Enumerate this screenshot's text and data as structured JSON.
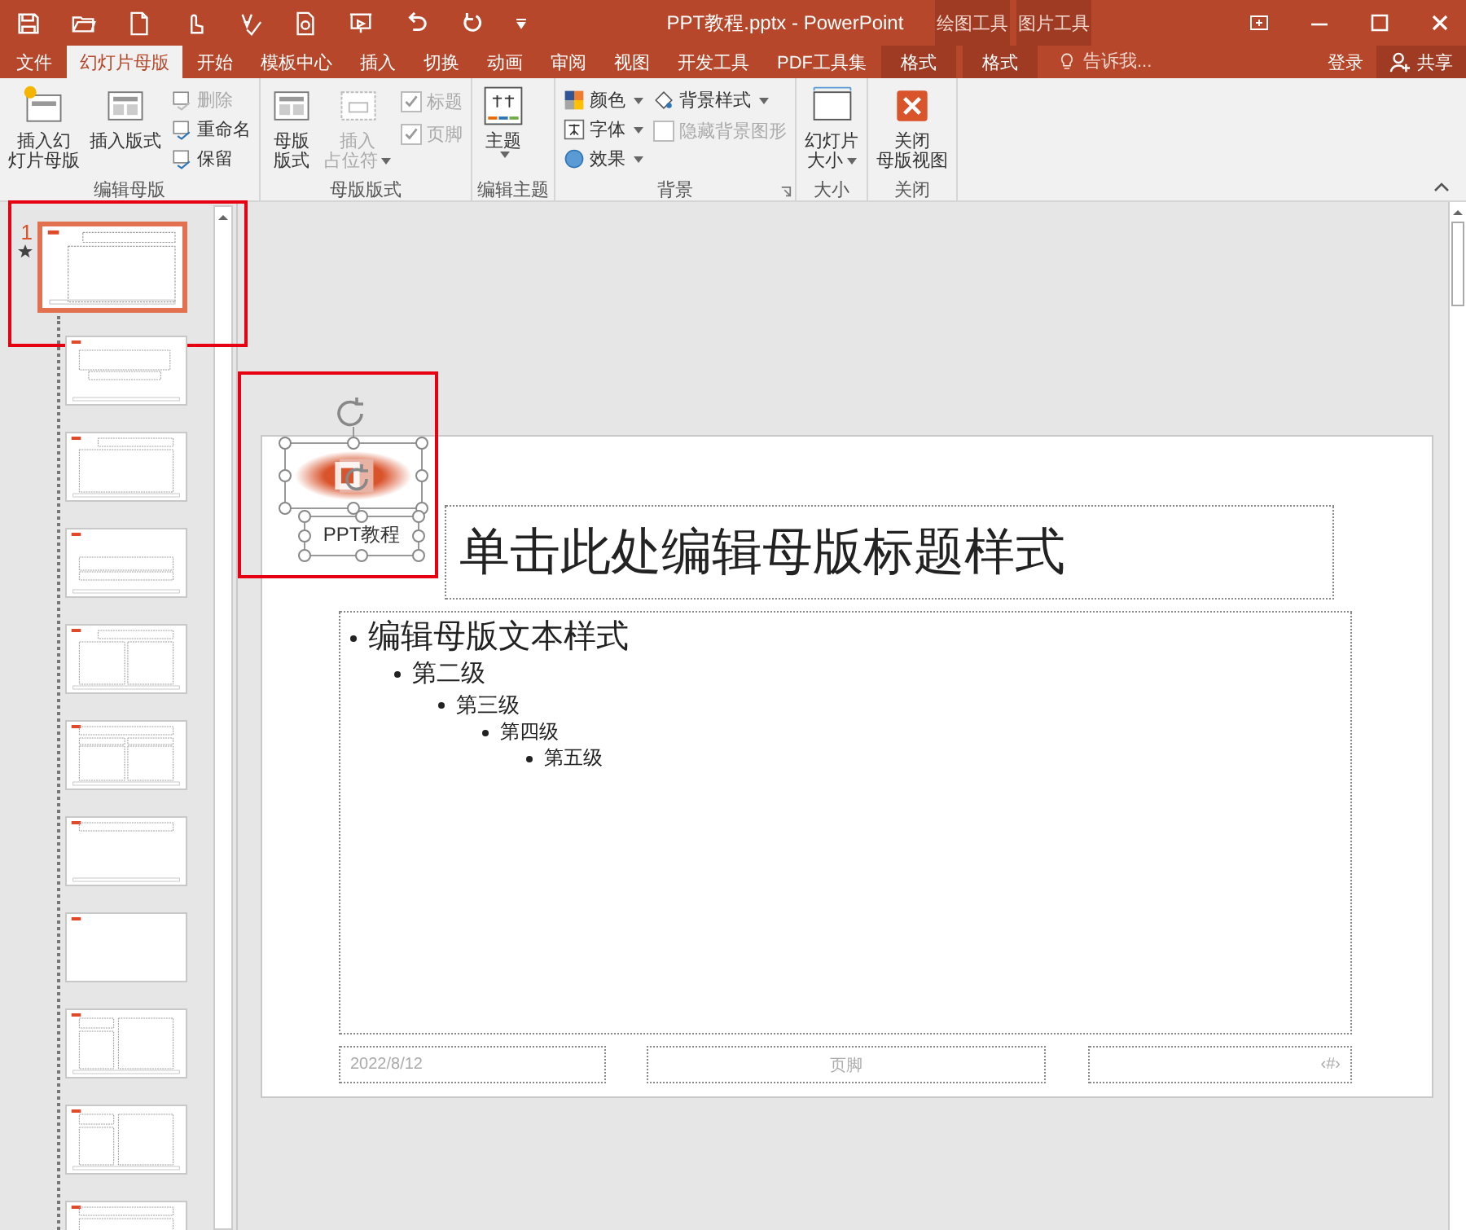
{
  "title_bar": {
    "title": "PPT教程.pptx - PowerPoint",
    "context_groups": [
      "绘图工具",
      "图片工具"
    ]
  },
  "tabs": [
    {
      "label": "文件",
      "kind": "file",
      "selected": false
    },
    {
      "label": "幻灯片母版",
      "kind": "normal",
      "selected": true
    },
    {
      "label": "开始",
      "kind": "normal",
      "selected": false
    },
    {
      "label": "模板中心",
      "kind": "normal",
      "selected": false
    },
    {
      "label": "插入",
      "kind": "normal",
      "selected": false
    },
    {
      "label": "切换",
      "kind": "normal",
      "selected": false
    },
    {
      "label": "动画",
      "kind": "normal",
      "selected": false
    },
    {
      "label": "审阅",
      "kind": "normal",
      "selected": false
    },
    {
      "label": "视图",
      "kind": "normal",
      "selected": false
    },
    {
      "label": "开发工具",
      "kind": "normal",
      "selected": false
    },
    {
      "label": "PDF工具集",
      "kind": "normal",
      "selected": false
    },
    {
      "label": "格式",
      "kind": "context",
      "selected": false
    },
    {
      "label": "格式",
      "kind": "context",
      "selected": false
    }
  ],
  "tell_me": {
    "placeholder": "告诉我..."
  },
  "sign_in": "登录",
  "share": "共享",
  "ribbon": {
    "groups": [
      {
        "label": "编辑母版",
        "launcher": false,
        "commands": [
          {
            "kind": "large",
            "lines": [
              "插入幻",
              "灯片母版"
            ],
            "disabled": false,
            "dropdown": false
          },
          {
            "kind": "large",
            "lines": [
              "插入版式"
            ],
            "disabled": false,
            "dropdown": false
          },
          {
            "kind": "small",
            "lines": [
              "删除"
            ],
            "disabled": true,
            "dropdown": false
          },
          {
            "kind": "small",
            "lines": [
              "重命名"
            ],
            "disabled": false,
            "dropdown": false
          },
          {
            "kind": "small",
            "lines": [
              "保留"
            ],
            "disabled": false,
            "dropdown": false
          }
        ]
      },
      {
        "label": "母版版式",
        "launcher": false,
        "commands": [
          {
            "kind": "large",
            "lines": [
              "母版",
              "版式"
            ],
            "disabled": false,
            "dropdown": false
          },
          {
            "kind": "large",
            "lines": [
              "插入",
              "占位符"
            ],
            "disabled": true,
            "dropdown": true
          },
          {
            "kind": "check",
            "lines": [
              "标题"
            ],
            "disabled": true,
            "checked": true
          },
          {
            "kind": "check",
            "lines": [
              "页脚"
            ],
            "disabled": true,
            "checked": true
          }
        ]
      },
      {
        "label": "编辑主题",
        "launcher": false,
        "commands": [
          {
            "kind": "large",
            "lines": [
              "主题"
            ],
            "disabled": false,
            "dropdown": true
          }
        ]
      },
      {
        "label": "背景",
        "launcher": true,
        "commands": [
          {
            "kind": "small",
            "lines": [
              "颜色"
            ],
            "disabled": false,
            "dropdown": true
          },
          {
            "kind": "small",
            "lines": [
              "字体"
            ],
            "disabled": false,
            "dropdown": true
          },
          {
            "kind": "small",
            "lines": [
              "效果"
            ],
            "disabled": false,
            "dropdown": true
          },
          {
            "kind": "small",
            "lines": [
              "背景样式"
            ],
            "disabled": false,
            "dropdown": true
          },
          {
            "kind": "check",
            "lines": [
              "隐藏背景图形"
            ],
            "disabled": true,
            "checked": false
          }
        ]
      },
      {
        "label": "大小",
        "launcher": false,
        "commands": [
          {
            "kind": "large",
            "lines": [
              "幻灯片",
              "大小"
            ],
            "disabled": false,
            "dropdown": true
          }
        ]
      },
      {
        "label": "关闭",
        "launcher": false,
        "commands": [
          {
            "kind": "large",
            "lines": [
              "关闭",
              "母版视图"
            ],
            "disabled": false,
            "dropdown": false
          }
        ]
      }
    ]
  },
  "thumbnails": [
    {
      "number": "1",
      "kind": "master",
      "selected": true,
      "animated": true
    },
    {
      "kind": "title",
      "selected": false,
      "animated": false
    },
    {
      "kind": "content",
      "selected": false,
      "animated": false
    },
    {
      "kind": "section",
      "selected": false,
      "animated": false
    },
    {
      "kind": "two",
      "selected": false,
      "animated": false
    },
    {
      "kind": "compare",
      "selected": false,
      "animated": false
    },
    {
      "kind": "titleonly",
      "selected": false,
      "animated": false
    },
    {
      "kind": "blank",
      "selected": false,
      "animated": false
    },
    {
      "kind": "caption",
      "selected": false,
      "animated": false
    },
    {
      "kind": "picture",
      "selected": false,
      "animated": false
    },
    {
      "kind": "vertical",
      "selected": false,
      "animated": false
    }
  ],
  "slide": {
    "logo": {
      "caption": "PPT教程",
      "selected": true
    },
    "title": "单击此处编辑母版标题样式",
    "body": [
      {
        "text": "编辑母版文本样式",
        "children": [
          {
            "text": "第二级",
            "children": [
              {
                "text": "第三级",
                "children": [
                  {
                    "text": "第四级",
                    "children": [
                      {
                        "text": "第五级"
                      }
                    ]
                  }
                ]
              }
            ]
          }
        ]
      }
    ],
    "footer": {
      "date": "2022/8/12",
      "text": "页脚",
      "number": "‹#›"
    }
  }
}
